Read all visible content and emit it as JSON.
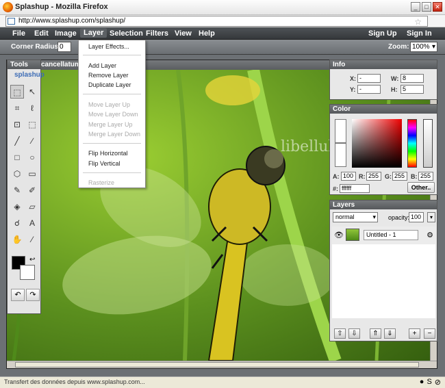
{
  "browser": {
    "title": "Splashup - Mozilla Firefox",
    "url": "http://www.splashup.com/splashup/",
    "status": "Transfert des données depuis www.splashup.com..."
  },
  "menu": {
    "items": [
      "File",
      "Edit",
      "Image",
      "Layer",
      "Selection",
      "Filters",
      "View",
      "Help"
    ],
    "sign_up": "Sign Up",
    "sign_in": "Sign In"
  },
  "options": {
    "corner_radius_label": "Corner Radius:",
    "corner_radius_value": "0",
    "zoom_label": "Zoom:",
    "zoom_value": "100%"
  },
  "image": {
    "title": "cancellatum",
    "watermark": "libellules.ch"
  },
  "tools": {
    "title": "Tools",
    "brand": "splashup"
  },
  "layer_menu": {
    "items": [
      {
        "label": "Layer Effects...",
        "enabled": true
      },
      {
        "label": "Add Layer",
        "enabled": true
      },
      {
        "label": "Remove Layer",
        "enabled": true
      },
      {
        "label": "Duplicate Layer",
        "enabled": true
      },
      {
        "label": "Move Layer Up",
        "enabled": false
      },
      {
        "label": "Move Layer Down",
        "enabled": false
      },
      {
        "label": "Merge Layer Up",
        "enabled": false
      },
      {
        "label": "Merge Layer Down",
        "enabled": false
      },
      {
        "label": "Flip Horizontal",
        "enabled": true
      },
      {
        "label": "Flip Vertical",
        "enabled": true
      },
      {
        "label": "Rasterize",
        "enabled": false
      }
    ]
  },
  "info": {
    "title": "Info",
    "x_label": "X:",
    "x_value": "-",
    "y_label": "Y:",
    "y_value": "-",
    "w_label": "W:",
    "w_value": "8",
    "h_label": "H:",
    "h_value": "5"
  },
  "color": {
    "title": "Color",
    "a_label": "A:",
    "a_value": "100",
    "r_label": "R:",
    "r_value": "255",
    "g_label": "G:",
    "g_value": "255",
    "b_label": "B:",
    "b_value": "255",
    "hex_label": "#:",
    "hex_value": "ffffff",
    "other_button": "Other.."
  },
  "layers": {
    "title": "Layers",
    "blend_mode": "normal",
    "opacity_label": "opacity:",
    "opacity_value": "100",
    "layer_name": "Untitled - 1"
  }
}
